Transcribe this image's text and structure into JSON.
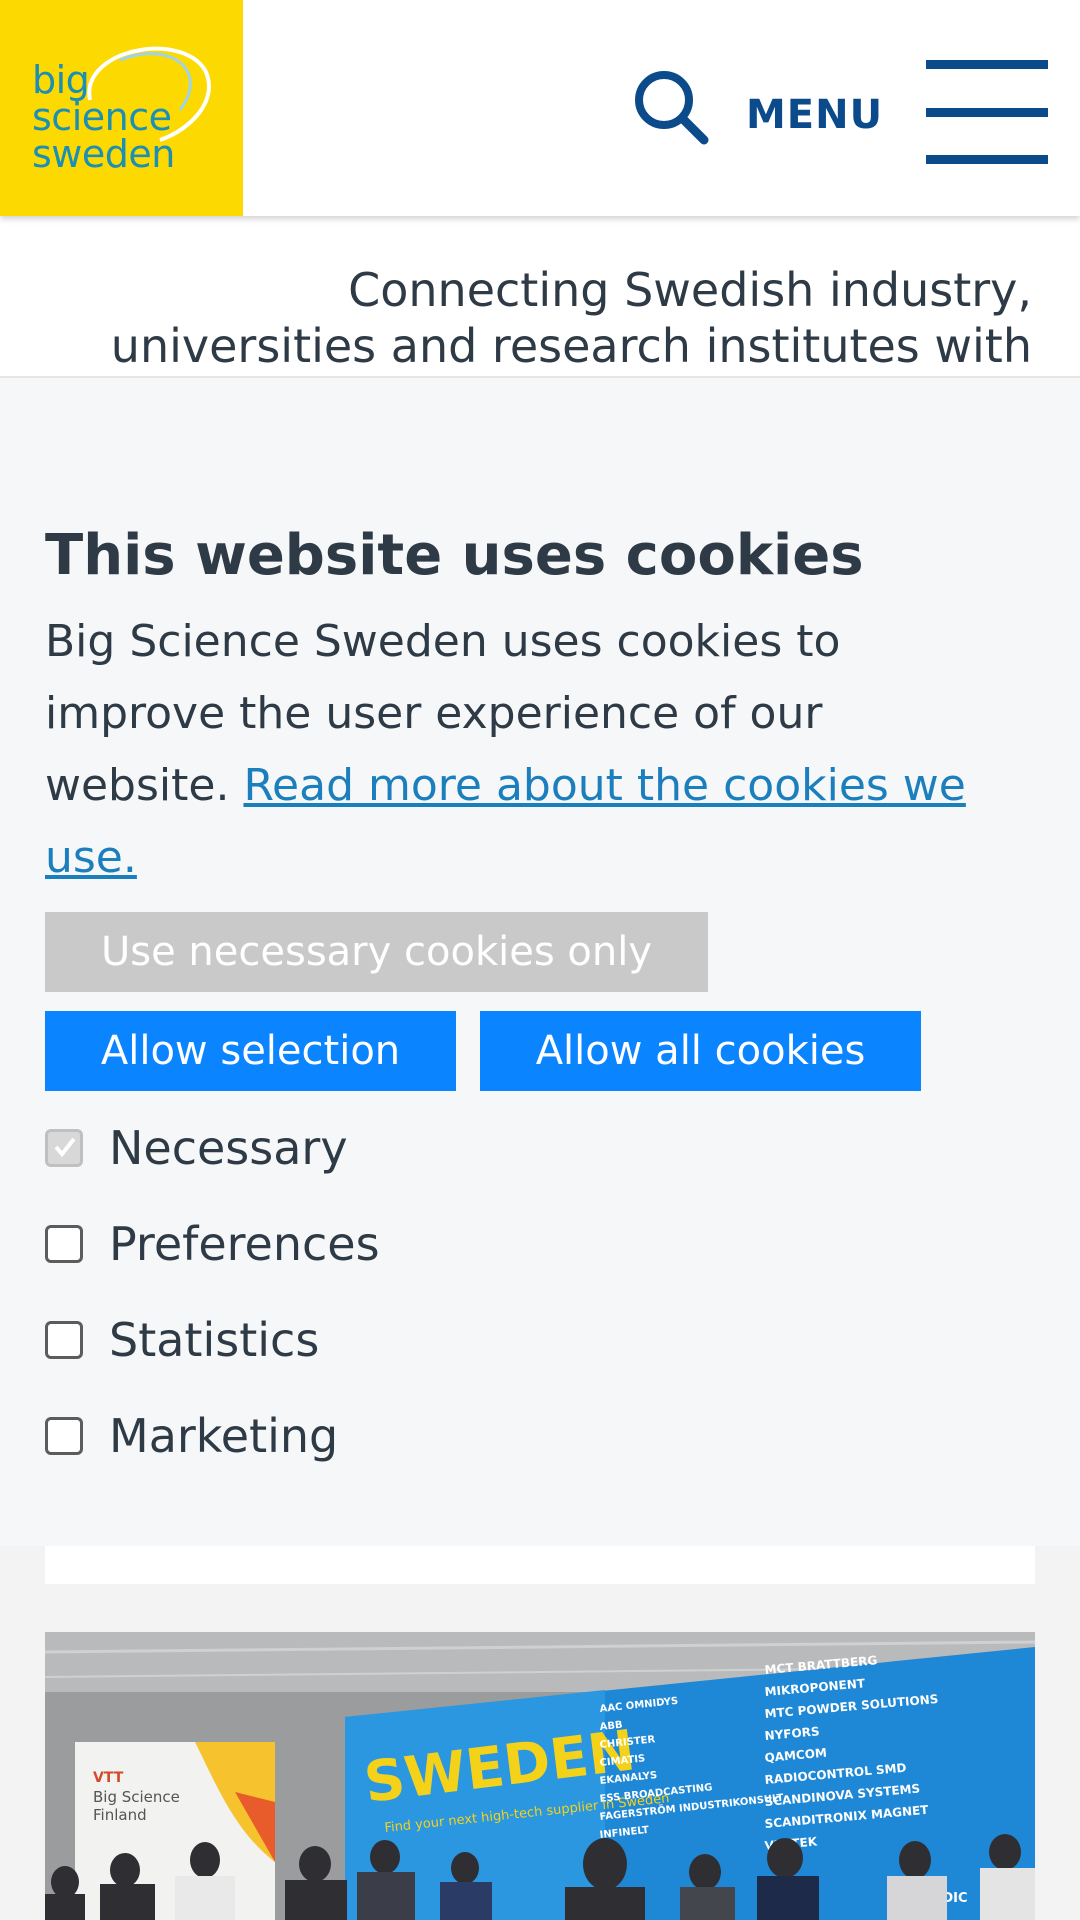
{
  "header": {
    "logo": {
      "line1": "big",
      "line2": "science",
      "line3": "sweden"
    },
    "menu_label": "MENU",
    "icons": {
      "search": "search-icon",
      "menu": "hamburger-icon"
    },
    "colors": {
      "logo_bg": "#fcd900",
      "logo_text": "#1b8fb4",
      "nav": "#0b4a8b"
    }
  },
  "tagline": {
    "line1": "Connecting Swedish industry,",
    "line2": "universities and research institutes with"
  },
  "cookie_banner": {
    "title": "This website uses cookies",
    "body_text": "Big Science Sweden uses cookies to improve the user experience of our website. ",
    "link_text": "Read more about the cookies we use.",
    "buttons": {
      "necessary_only": "Use necessary cookies only",
      "allow_selection": "Allow selection",
      "allow_all": "Allow all cookies"
    },
    "options": [
      {
        "label": "Necessary",
        "checked": true,
        "disabled": true
      },
      {
        "label": "Preferences",
        "checked": false
      },
      {
        "label": "Statistics",
        "checked": false
      },
      {
        "label": "Marketing",
        "checked": false
      }
    ],
    "colors": {
      "primary_button": "#0a84ff",
      "disabled_button": "#c9c9c9",
      "link": "#1b7fbd",
      "text": "#2e3a45"
    }
  },
  "photo": {
    "booth_sign": "SWEDEN",
    "booth_subtitle": "Find your next high-tech supplier in Sweden",
    "side_sign_line1": "Big Science",
    "side_sign_line2": "Finland",
    "side_tag": "VTT",
    "exhibitors": [
      "MCT BRATTBERG",
      "MIKROPONENT",
      "MTC POWDER SOLUTIONS",
      "NYFORS",
      "QAMCOM",
      "RADIOCONTROL SMD",
      "SCANDINOVA SYSTEMS",
      "SCANDITRONIX MAGNET",
      "VISITEK"
    ],
    "exhibitors_left": [
      "AAC OMNIDYS",
      "ABB",
      "CHRISTER",
      "CIMATIS",
      "EKANALYS",
      "ESS BROADCASTING",
      "FAGERSTRÖM INDUSTRIKONSULT",
      "INFINELT"
    ],
    "bottom_tag": "N NORDIC"
  }
}
